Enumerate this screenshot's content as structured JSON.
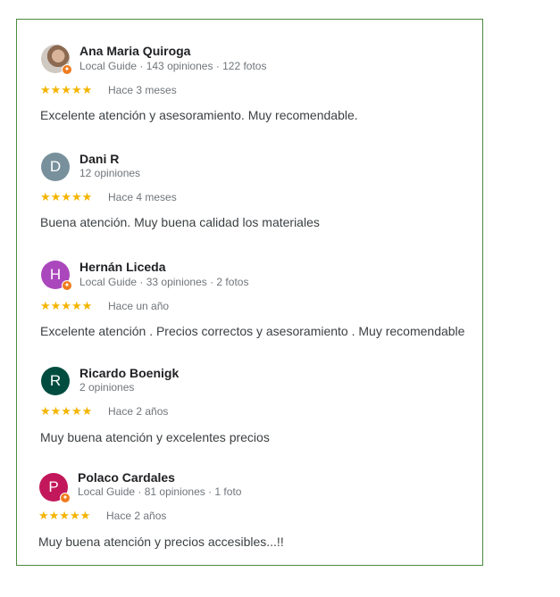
{
  "reviews": [
    {
      "name": "Ana Maria Quiroga",
      "meta": "Local Guide · 143 opiniones · 122 fotos",
      "stars": "★★★★★",
      "rating": 5,
      "when": "Hace 3 meses",
      "text": "Excelente atención y asesoramiento. Muy recomendable.",
      "avatar": {
        "type": "photo",
        "letter": "",
        "color": "#8c6a52",
        "local_guide": true
      }
    },
    {
      "name": "Dani R",
      "meta": "12 opiniones",
      "stars": "★★★★★",
      "rating": 5,
      "when": "Hace 4 meses",
      "text": "Buena atención. Muy buena calidad los materiales",
      "avatar": {
        "type": "letter",
        "letter": "D",
        "color": "#78909c",
        "local_guide": false
      }
    },
    {
      "name": "Hernán Liceda",
      "meta": "Local Guide · 33 opiniones · 2 fotos",
      "stars": "★★★★★",
      "rating": 5,
      "when": "Hace un año",
      "text": "Excelente atención . Precios correctos y asesoramiento . Muy recomendable",
      "avatar": {
        "type": "letter",
        "letter": "H",
        "color": "#ab47bc",
        "local_guide": true
      }
    },
    {
      "name": "Ricardo Boenigk",
      "meta": "2 opiniones",
      "stars": "★★★★★",
      "rating": 5,
      "when": "Hace 2 años",
      "text": "Muy buena atención y excelentes precios",
      "avatar": {
        "type": "letter",
        "letter": "R",
        "color": "#004d40",
        "local_guide": false
      }
    },
    {
      "name": "Polaco Cardales",
      "meta": "Local Guide · 81 opiniones · 1 foto",
      "stars": "★★★★★",
      "rating": 5,
      "when": "Hace 2 años",
      "text": "Muy buena atención y precios accesibles...!!",
      "avatar": {
        "type": "letter",
        "letter": "P",
        "color": "#c2185b",
        "local_guide": true
      }
    }
  ],
  "colors": {
    "star": "#f4b400",
    "border": "#4a8a3e",
    "badge": "#ef7a1c"
  }
}
